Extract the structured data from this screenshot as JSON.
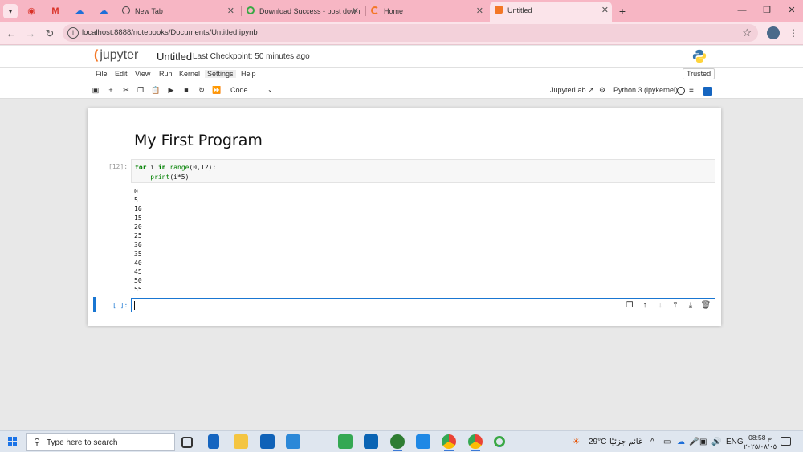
{
  "browser": {
    "tabs": [
      {
        "label": "New Tab"
      },
      {
        "label": "Download Success - post down"
      },
      {
        "label": "Home"
      },
      {
        "label": "Untitled"
      }
    ],
    "url": "localhost:8888/notebooks/Documents/Untitled.ipynb"
  },
  "jupyter": {
    "logo_text": "jupyter",
    "notebook_title": "Untitled",
    "checkpoint": "Last Checkpoint: 50 minutes ago",
    "menu": [
      "File",
      "Edit",
      "View",
      "Run",
      "Kernel",
      "Settings",
      "Help"
    ],
    "trusted": "Trusted",
    "cell_type": "Code",
    "jupyterlab_link": "JupyterLab",
    "kernel_name": "Python 3 (ipykernel)"
  },
  "notebook": {
    "heading": "My First Program",
    "code_cell": {
      "prompt": "[12]:",
      "line1_kw": "for",
      "line1_var": " i ",
      "line1_in": "in",
      "line1_fn": " range",
      "line1_args": "(0,12):",
      "line2_indent": "    ",
      "line2_fn": "print",
      "line2_args": "(i*5)"
    },
    "output": [
      "0",
      "5",
      "10",
      "15",
      "20",
      "25",
      "30",
      "35",
      "40",
      "45",
      "50",
      "55"
    ],
    "empty_cell_prompt": "[ ]:"
  },
  "taskbar": {
    "search_placeholder": "Type here to search",
    "weather": "29°C",
    "weather_desc": "غائم جزئيًا",
    "lang": "ENG",
    "time": "08:58 م",
    "date": "٢٠٢٥/٠٨/٠٥"
  }
}
